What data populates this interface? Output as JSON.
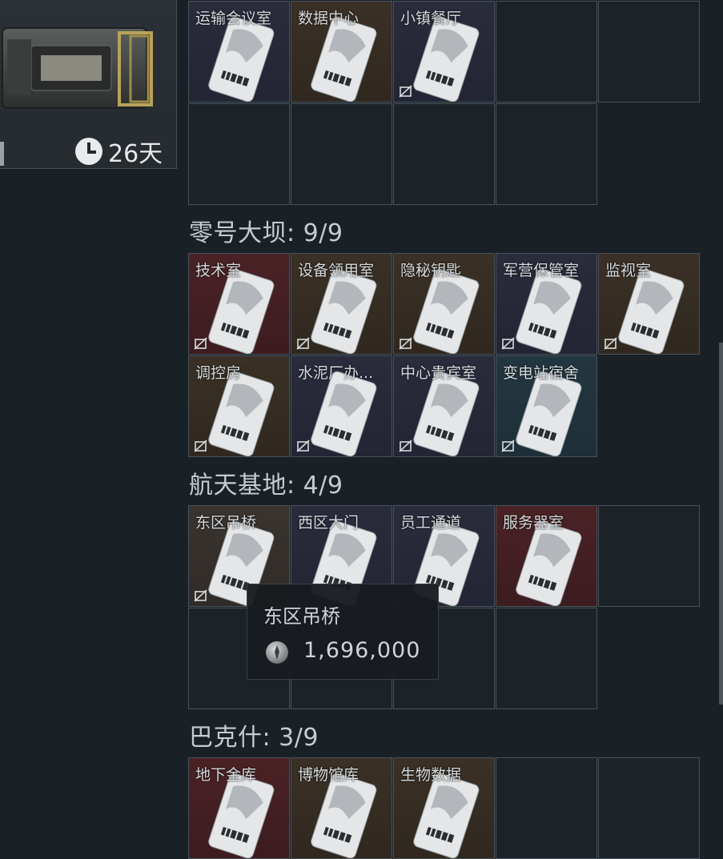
{
  "case": {
    "timer_label": "26天"
  },
  "sections": [
    {
      "title": "",
      "rows": [
        [
          "运输会议室",
          "数据中心",
          "小镇餐厅",
          null,
          null
        ],
        [
          null,
          null,
          null,
          null
        ]
      ]
    },
    {
      "title": "零号大坝: 9/9"
    },
    {
      "title": "航天基地: 4/9"
    },
    {
      "title": "巴克什: 3/9"
    }
  ],
  "cards": {
    "s0": [
      {
        "label": "运输会议室",
        "bg": "navy",
        "noflag": false
      },
      {
        "label": "数据中心",
        "bg": "brown",
        "noflag": false
      },
      {
        "label": "小镇餐厅",
        "bg": "navy",
        "noflag": true
      }
    ],
    "dam": [
      {
        "label": "技术室",
        "bg": "red"
      },
      {
        "label": "设备领用室",
        "bg": "brown"
      },
      {
        "label": "隐秘钥匙",
        "bg": "brown"
      },
      {
        "label": "军营保管室",
        "bg": "navy"
      },
      {
        "label": "监视室",
        "bg": "brown"
      },
      {
        "label": "调控房",
        "bg": "brown"
      },
      {
        "label": "水泥厂办...",
        "bg": "navy"
      },
      {
        "label": "中心贵宾室",
        "bg": "navy"
      },
      {
        "label": "变电站宿舍",
        "bg": "teal"
      }
    ],
    "space": [
      {
        "label": "东区吊桥",
        "bg": "greybrown"
      },
      {
        "label": "西区大门",
        "bg": "navy"
      },
      {
        "label": "员工通道",
        "bg": "navy"
      },
      {
        "label": "服务器室",
        "bg": "red"
      }
    ],
    "bakesh": [
      {
        "label": "地下金库",
        "bg": "red"
      },
      {
        "label": "博物馆库",
        "bg": "brown"
      },
      {
        "label": "生物数据",
        "bg": "brown"
      }
    ]
  },
  "tooltip": {
    "title": "东区吊桥",
    "price": "1,696,000"
  },
  "colors": {
    "accent": "#c6cbcf",
    "background": "#1a2126",
    "cell_border": "#48525a"
  }
}
